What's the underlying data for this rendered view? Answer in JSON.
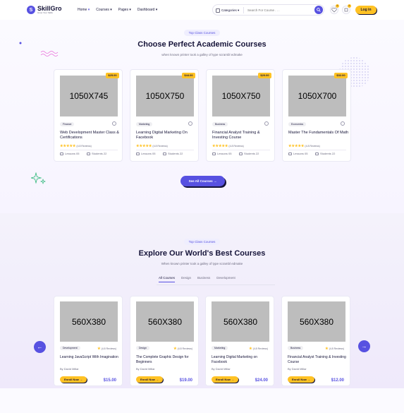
{
  "header": {
    "logo_mark": "S",
    "logo_name": "SkillGro",
    "logo_tagline": "Grow Your Skills",
    "nav": [
      "Home",
      "Courses",
      "Pages",
      "Dashboard"
    ],
    "category_label": "Categories",
    "search_placeholder": "Search For Course . . .",
    "wishlist_count": "0",
    "cart_count": "0",
    "login_label": "Log in"
  },
  "top_section": {
    "pill": "Top Class Courses",
    "title": "Choose Perfect Academic Courses",
    "subtitle": "when known printer took a galley of type scrambl edmake",
    "see_all": "See All Courses",
    "courses": [
      {
        "image": "1050X745",
        "price": "$25.00",
        "tag": "Finance",
        "title": "Web Development Master Class & Certifications",
        "rating": "(4.8 Reviews)",
        "lessons": "Lessons 05",
        "students": "Students 22"
      },
      {
        "image": "1050X750",
        "price": "$44.00",
        "tag": "Marketing",
        "title": "Learning Digital Marketing On Facebook",
        "rating": "(4.8 Reviews)",
        "lessons": "Lessons 05",
        "students": "Students 22"
      },
      {
        "image": "1050X750",
        "price": "$20.00",
        "tag": "Business",
        "title": "Financial Analyst Training & Investing Course",
        "rating": "(4.8 Reviews)",
        "lessons": "Lessons 05",
        "students": "Students 22"
      },
      {
        "image": "1050X700",
        "price": "$32.00",
        "tag": "Economics",
        "title": "Master The Fundamentals Of Math",
        "rating": "(4.8 Reviews)",
        "lessons": "Lessons 05",
        "students": "Students 22"
      }
    ]
  },
  "bottom_section": {
    "pill": "Top Class Courses",
    "title": "Explore Our World's Best Courses",
    "subtitle": "When known printer took a galley of type scrambl edmake",
    "tabs": [
      "All Courses",
      "Design",
      "Business",
      "Development"
    ],
    "enroll_label": "Enroll Now",
    "courses": [
      {
        "image": "560X380",
        "tag": "Development",
        "rating": "(4.8 Reviews)",
        "title": "Learning JavaScript With Imagination",
        "author": "By David Millar",
        "price": "$15.00"
      },
      {
        "image": "560X380",
        "tag": "Design",
        "rating": "(4.8 Reviews)",
        "title": "The Complete Graphic Design for Beginners",
        "author": "By David Millar",
        "price": "$19.00"
      },
      {
        "image": "560X380",
        "tag": "Marketing",
        "rating": "(4.8 Reviews)",
        "title": "Learning Digital Marketing on Facebook",
        "author": "By David Millar",
        "price": "$24.00"
      },
      {
        "image": "560X380",
        "tag": "Business",
        "rating": "(4.8 Reviews)",
        "title": "Financial Analyst Training & Investing Course",
        "author": "By David Millar",
        "price": "$12.00"
      }
    ]
  },
  "colors": {
    "primary": "#5751e1",
    "accent": "#ffc224",
    "dark": "#161439"
  }
}
